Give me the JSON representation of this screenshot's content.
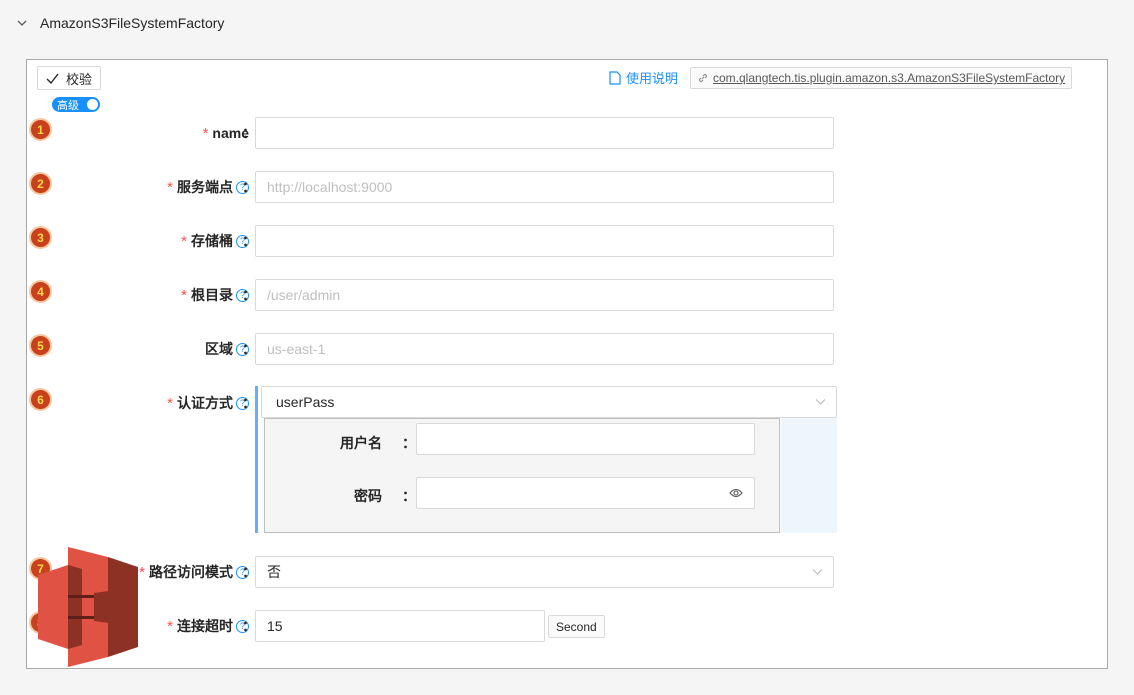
{
  "header": {
    "title": "AmazonS3FileSystemFactory"
  },
  "toolbar": {
    "verify_label": "校验",
    "advanced_label": "高级",
    "doc_link_label": "使用说明",
    "class_name": "com.qlangtech.tis.plugin.amazon.s3.AmazonS3FileSystemFactory"
  },
  "form": {
    "colon": "：",
    "required_mark": "*",
    "help_mark": "?",
    "fields": [
      {
        "index": "1",
        "label": "name",
        "required": true,
        "help": false,
        "value": "",
        "placeholder": ""
      },
      {
        "index": "2",
        "label": "服务端点",
        "required": true,
        "help": true,
        "value": "",
        "placeholder": "http://localhost:9000"
      },
      {
        "index": "3",
        "label": "存储桶",
        "required": true,
        "help": true,
        "value": "",
        "placeholder": ""
      },
      {
        "index": "4",
        "label": "根目录",
        "required": true,
        "help": true,
        "value": "",
        "placeholder": "/user/admin"
      },
      {
        "index": "5",
        "label": "区域",
        "required": false,
        "help": true,
        "value": "",
        "placeholder": "us-east-1"
      },
      {
        "index": "6",
        "label": "认证方式",
        "required": true,
        "help": true,
        "value": "userPass"
      },
      {
        "index": "7",
        "label": "路径访问模式",
        "required": true,
        "help": true,
        "value": "否"
      },
      {
        "index": "8",
        "label": "连接超时",
        "required": true,
        "help": true,
        "value": "15",
        "unit": "Second"
      }
    ],
    "auth": {
      "username_label": "用户名",
      "password_label": "密码",
      "username_value": "",
      "password_value": ""
    }
  },
  "colors": {
    "accent": "#1890ff",
    "required": "#ff4d4f",
    "badge": "#c8401c",
    "logo": "#e05243"
  },
  "icons": [
    "chevron-down-icon",
    "check-icon",
    "document-icon",
    "link-icon",
    "help-icon",
    "eye-icon",
    "amazon-s3-logo"
  ]
}
